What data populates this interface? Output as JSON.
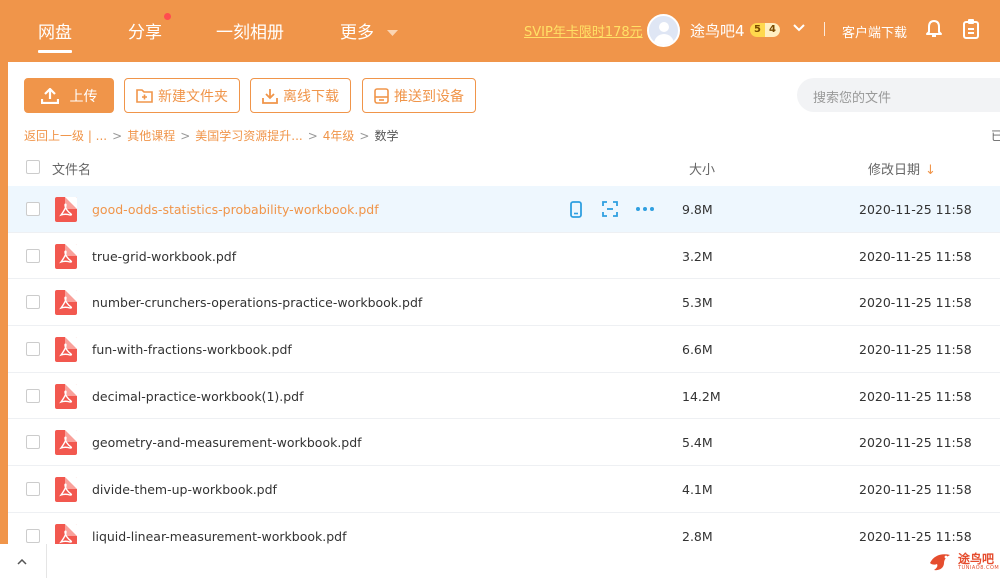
{
  "nav": {
    "items": [
      "网盘",
      "分享",
      "一刻相册",
      "更多"
    ],
    "svip_promo": "SVIP年卡限时178元",
    "username": "途鸟吧4",
    "badge_left": "5",
    "badge_right": "4",
    "client_download": "客户端下载"
  },
  "toolbar": {
    "upload": "上传",
    "new_folder": "新建文件夹",
    "offline_download": "离线下载",
    "push_to_device": "推送到设备",
    "search_placeholder": "搜索您的文件"
  },
  "breadcrumb": {
    "back": "返回上一级 | ...",
    "items": [
      "其他课程",
      "美国学习资源提升...",
      "4年级"
    ],
    "current": "数学",
    "right_clip": "已"
  },
  "table": {
    "col_name": "文件名",
    "col_size": "大小",
    "col_date": "修改日期",
    "rows": [
      {
        "name": "good-odds-statistics-probability-workbook.pdf",
        "size": "9.8M",
        "date": "2020-11-25 11:58",
        "selected": true
      },
      {
        "name": "true-grid-workbook.pdf",
        "size": "3.2M",
        "date": "2020-11-25 11:58"
      },
      {
        "name": "number-crunchers-operations-practice-workbook.pdf",
        "size": "5.3M",
        "date": "2020-11-25 11:58"
      },
      {
        "name": "fun-with-fractions-workbook.pdf",
        "size": "6.6M",
        "date": "2020-11-25 11:58"
      },
      {
        "name": "decimal-practice-workbook(1).pdf",
        "size": "14.2M",
        "date": "2020-11-25 11:58"
      },
      {
        "name": "geometry-and-measurement-workbook.pdf",
        "size": "5.4M",
        "date": "2020-11-25 11:58"
      },
      {
        "name": "divide-them-up-workbook.pdf",
        "size": "4.1M",
        "date": "2020-11-25 11:58"
      },
      {
        "name": "liquid-linear-measurement-workbook.pdf",
        "size": "2.8M",
        "date": "2020-11-25 11:58"
      }
    ]
  },
  "watermark": {
    "text": "途鸟吧",
    "sub": "TUNIAO8.COM"
  },
  "colors": {
    "accent": "#f0954a",
    "selected_row": "#eef7fe",
    "action_icon": "#2f9fe0"
  }
}
